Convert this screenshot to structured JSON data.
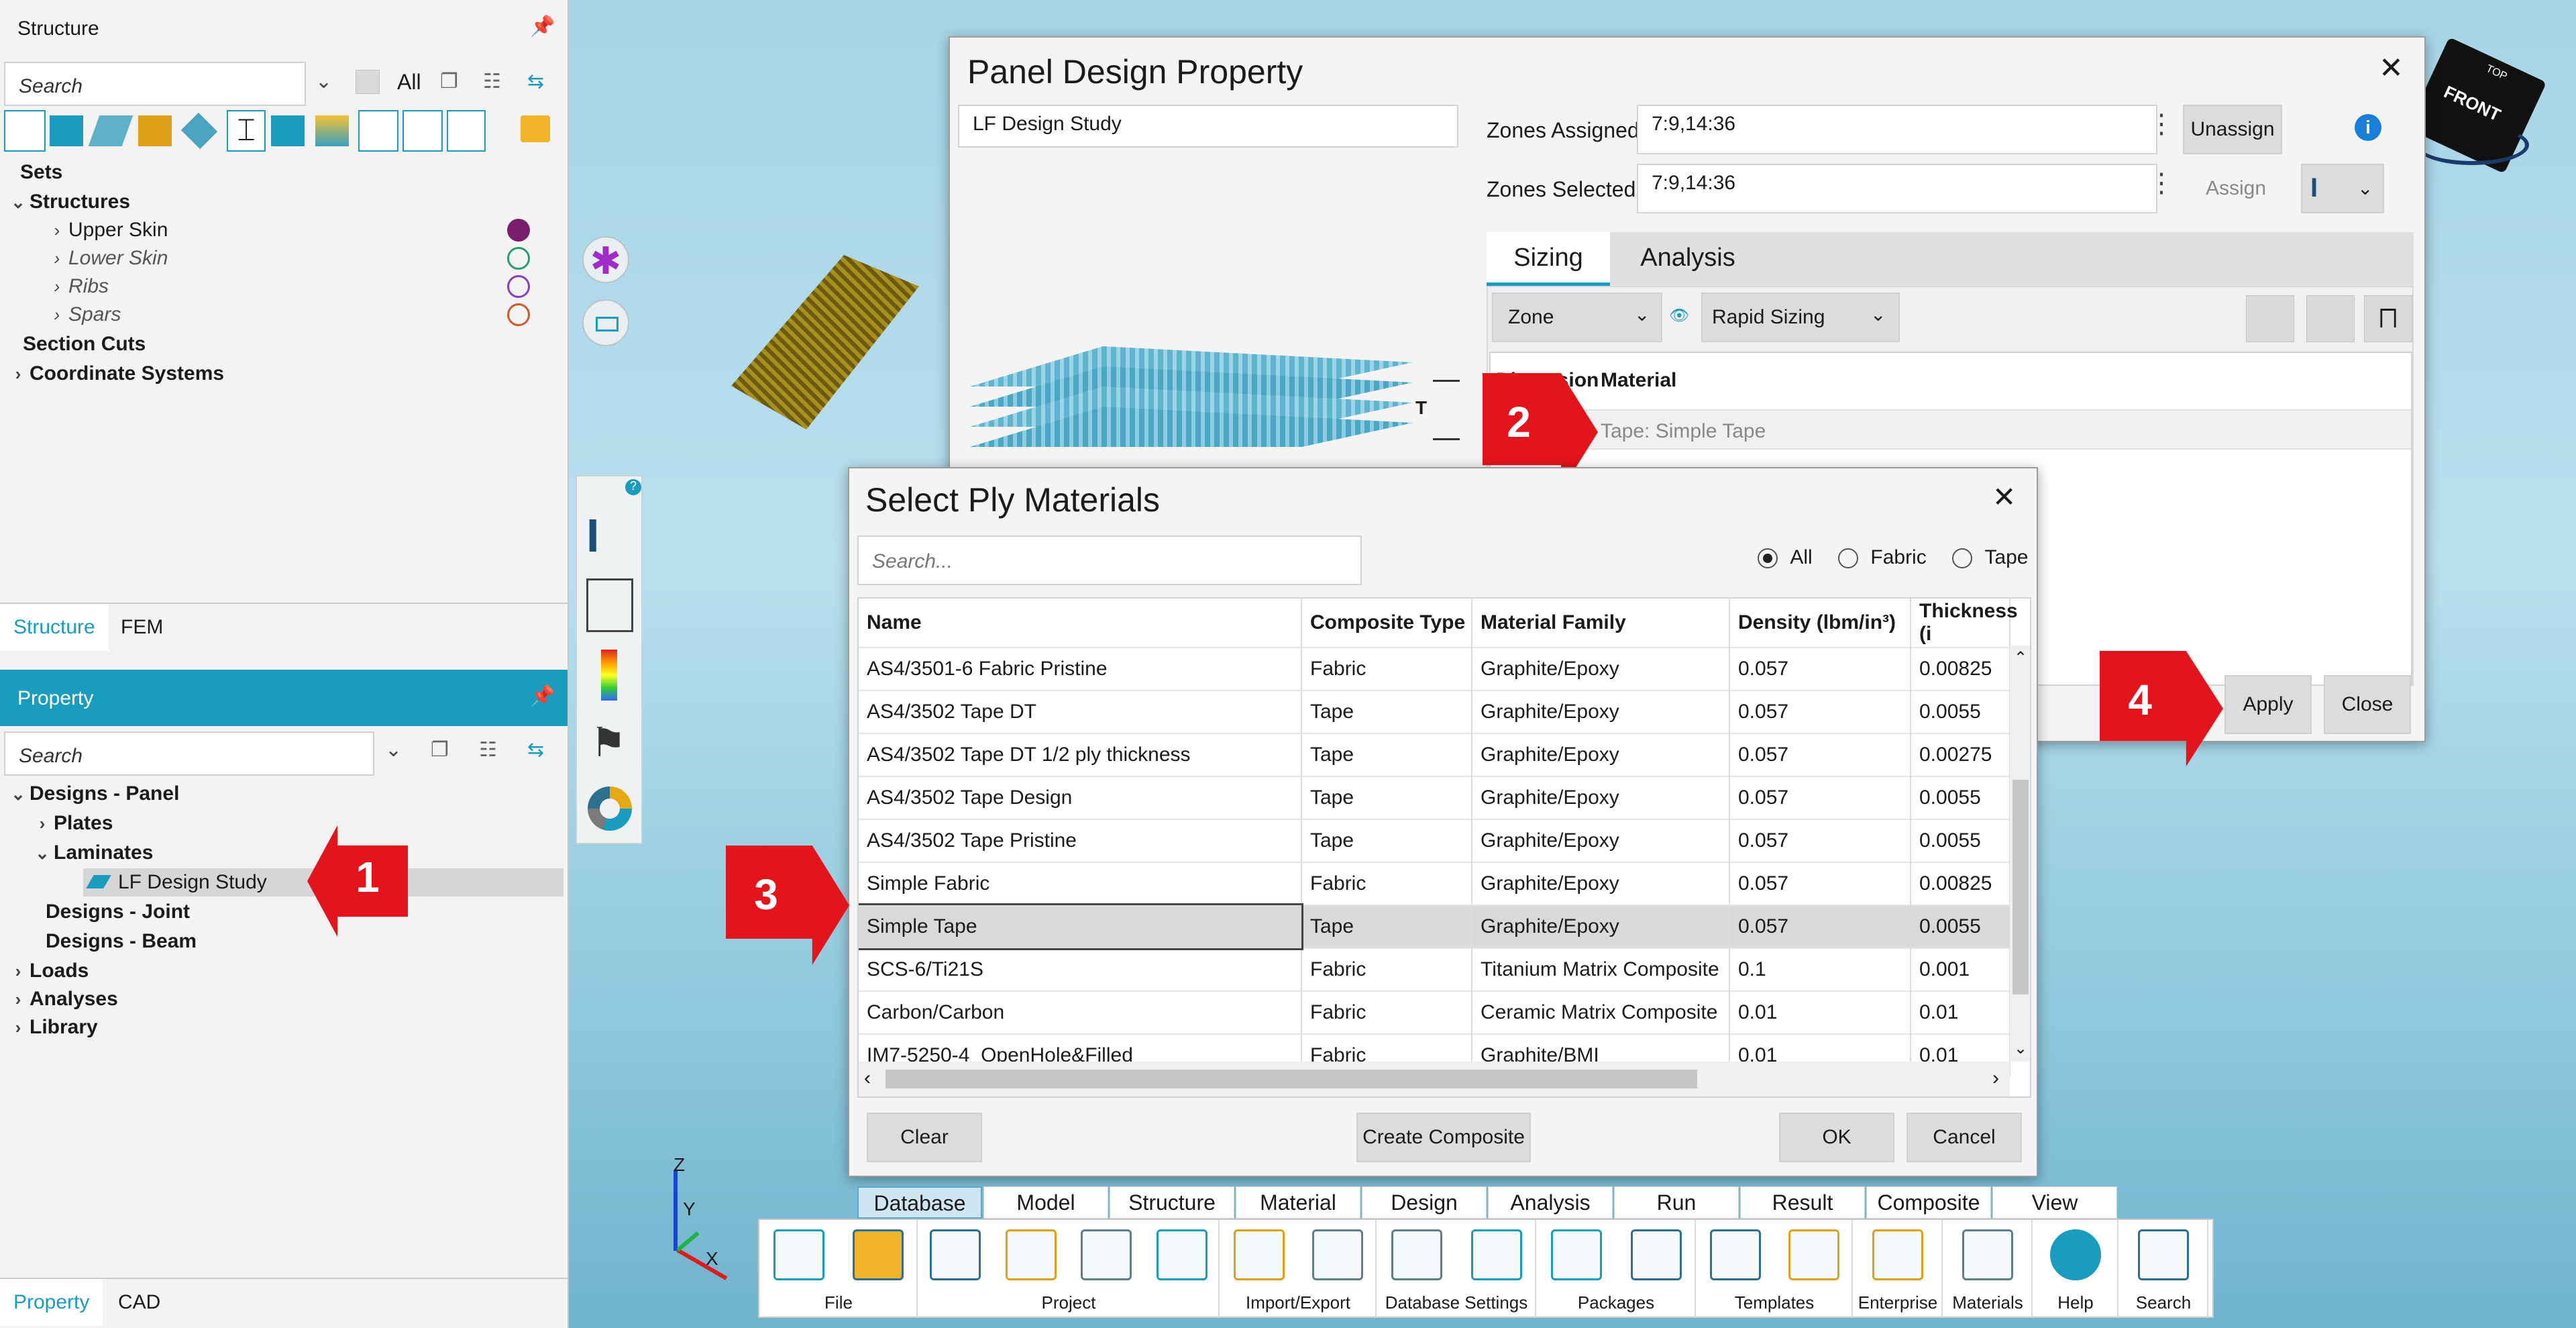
{
  "structure_panel": {
    "title": "Structure",
    "search_placeholder": "Search",
    "filter_label": "All",
    "tree": [
      {
        "label": "Sets",
        "bold": true
      },
      {
        "label": "Structures",
        "bold": true
      },
      {
        "label": "Upper Skin"
      },
      {
        "label": "Lower Skin",
        "italic": true
      },
      {
        "label": "Ribs",
        "italic": true
      },
      {
        "label": "Spars",
        "italic": true
      },
      {
        "label": "Section Cuts",
        "bold": true
      },
      {
        "label": "Coordinate Systems",
        "bold": true
      }
    ],
    "tabs": [
      "Structure",
      "FEM"
    ]
  },
  "property_panel": {
    "title": "Property",
    "search_placeholder": "Search",
    "tree": [
      "Designs - Panel",
      "Plates",
      "Laminates",
      "LF Design Study",
      "Designs - Joint",
      "Designs - Beam",
      "Loads",
      "Analyses",
      "Library"
    ],
    "bottom_tabs": [
      "Property",
      "CAD"
    ]
  },
  "panel_dialog": {
    "title": "Panel Design Property",
    "design_name": "LF Design Study",
    "zones_assigned_label": "Zones Assigned:",
    "zones_assigned_value": "7:9,14:36",
    "zones_selected_label": "Zones Selected:",
    "zones_selected_value": "7:9,14:36",
    "unassign": "Unassign",
    "assign": "Assign",
    "tabs": [
      "Sizing",
      "Analysis"
    ],
    "zone_dropdown": "Zone",
    "sizing_dropdown": "Rapid Sizing",
    "col_dimension": "Dimension",
    "col_material": "Material",
    "material_row": "Tape: Simple Tape",
    "thickness_mark": "T",
    "apply": "Apply",
    "close": "Close"
  },
  "select_dialog": {
    "title": "Select Ply Materials",
    "search_placeholder": "Search...",
    "filters": [
      "All",
      "Fabric",
      "Tape"
    ],
    "columns": [
      "Name",
      "Composite Type",
      "Material Family",
      "Density (lbm/in³)",
      "Thickness (i"
    ],
    "rows": [
      [
        "AS4/3501-6 Fabric Pristine",
        "Fabric",
        "Graphite/Epoxy",
        "0.057",
        "0.00825"
      ],
      [
        "AS4/3502 Tape DT",
        "Tape",
        "Graphite/Epoxy",
        "0.057",
        "0.0055"
      ],
      [
        "AS4/3502 Tape DT 1/2 ply thickness",
        "Tape",
        "Graphite/Epoxy",
        "0.057",
        "0.00275"
      ],
      [
        "AS4/3502 Tape Design",
        "Tape",
        "Graphite/Epoxy",
        "0.057",
        "0.0055"
      ],
      [
        "AS4/3502 Tape Pristine",
        "Tape",
        "Graphite/Epoxy",
        "0.057",
        "0.0055"
      ],
      [
        "Simple Fabric",
        "Fabric",
        "Graphite/Epoxy",
        "0.057",
        "0.00825"
      ],
      [
        "Simple Tape",
        "Tape",
        "Graphite/Epoxy",
        "0.057",
        "0.0055"
      ],
      [
        "SCS-6/Ti21S",
        "Fabric",
        "Titanium Matrix Composite",
        "0.1",
        "0.001"
      ],
      [
        "Carbon/Carbon",
        "Fabric",
        "Ceramic Matrix Composite",
        "0.01",
        "0.01"
      ],
      [
        "IM7-5250-4_OpenHole&Filled",
        "Fabric",
        "Graphite/BMI",
        "0.01",
        "0.01"
      ]
    ],
    "clear": "Clear",
    "create_composite": "Create Composite",
    "ok": "OK",
    "cancel": "Cancel"
  },
  "callouts": [
    "1",
    "2",
    "3",
    "4"
  ],
  "menu_tabs": [
    "Database",
    "Model",
    "Structure",
    "Material",
    "Design",
    "Analysis",
    "Run",
    "Result",
    "Composite",
    "View"
  ],
  "ribbon_groups": [
    "File",
    "Project",
    "Import/Export",
    "Database Settings",
    "Packages",
    "Templates",
    "Enterprise",
    "Materials",
    "Help",
    "Search"
  ],
  "view_cube": {
    "front": "FRONT",
    "top": "TOP"
  },
  "axes": {
    "z": "Z",
    "y": "Y",
    "x": "X"
  },
  "colors": {
    "accent": "#1a9cbf",
    "callout": "#e3141b",
    "selected_row": "#d9d9d9"
  }
}
